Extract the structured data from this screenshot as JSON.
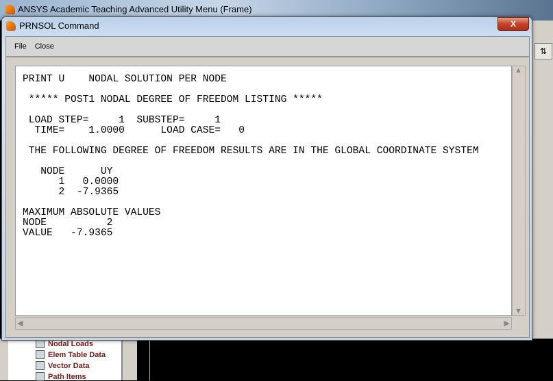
{
  "background_window": {
    "title": "ANSYS Academic Teaching Advanced Utility Menu (Frame)"
  },
  "tree_items": [
    "Nodal Loads",
    "Elem Table Data",
    "Vector Data",
    "Path Items"
  ],
  "dialog": {
    "title": "PRNSOL  Command",
    "close_label": "X",
    "menu": [
      "File",
      "Close"
    ],
    "listing": [
      "PRINT U    NODAL SOLUTION PER NODE",
      "",
      " ***** POST1 NODAL DEGREE OF FREEDOM LISTING *****",
      "",
      " LOAD STEP=     1  SUBSTEP=     1",
      "  TIME=    1.0000      LOAD CASE=   0",
      "",
      " THE FOLLOWING DEGREE OF FREEDOM RESULTS ARE IN THE GLOBAL COORDINATE SYSTEM",
      "",
      "   NODE      UY",
      "      1   0.0000",
      "      2  -7.9365",
      "",
      "MAXIMUM ABSOLUTE VALUES",
      "NODE          2",
      "VALUE   -7.9365"
    ]
  },
  "colors": {
    "tree_text": "#7a1a1a",
    "close_button": "#c2432a"
  }
}
